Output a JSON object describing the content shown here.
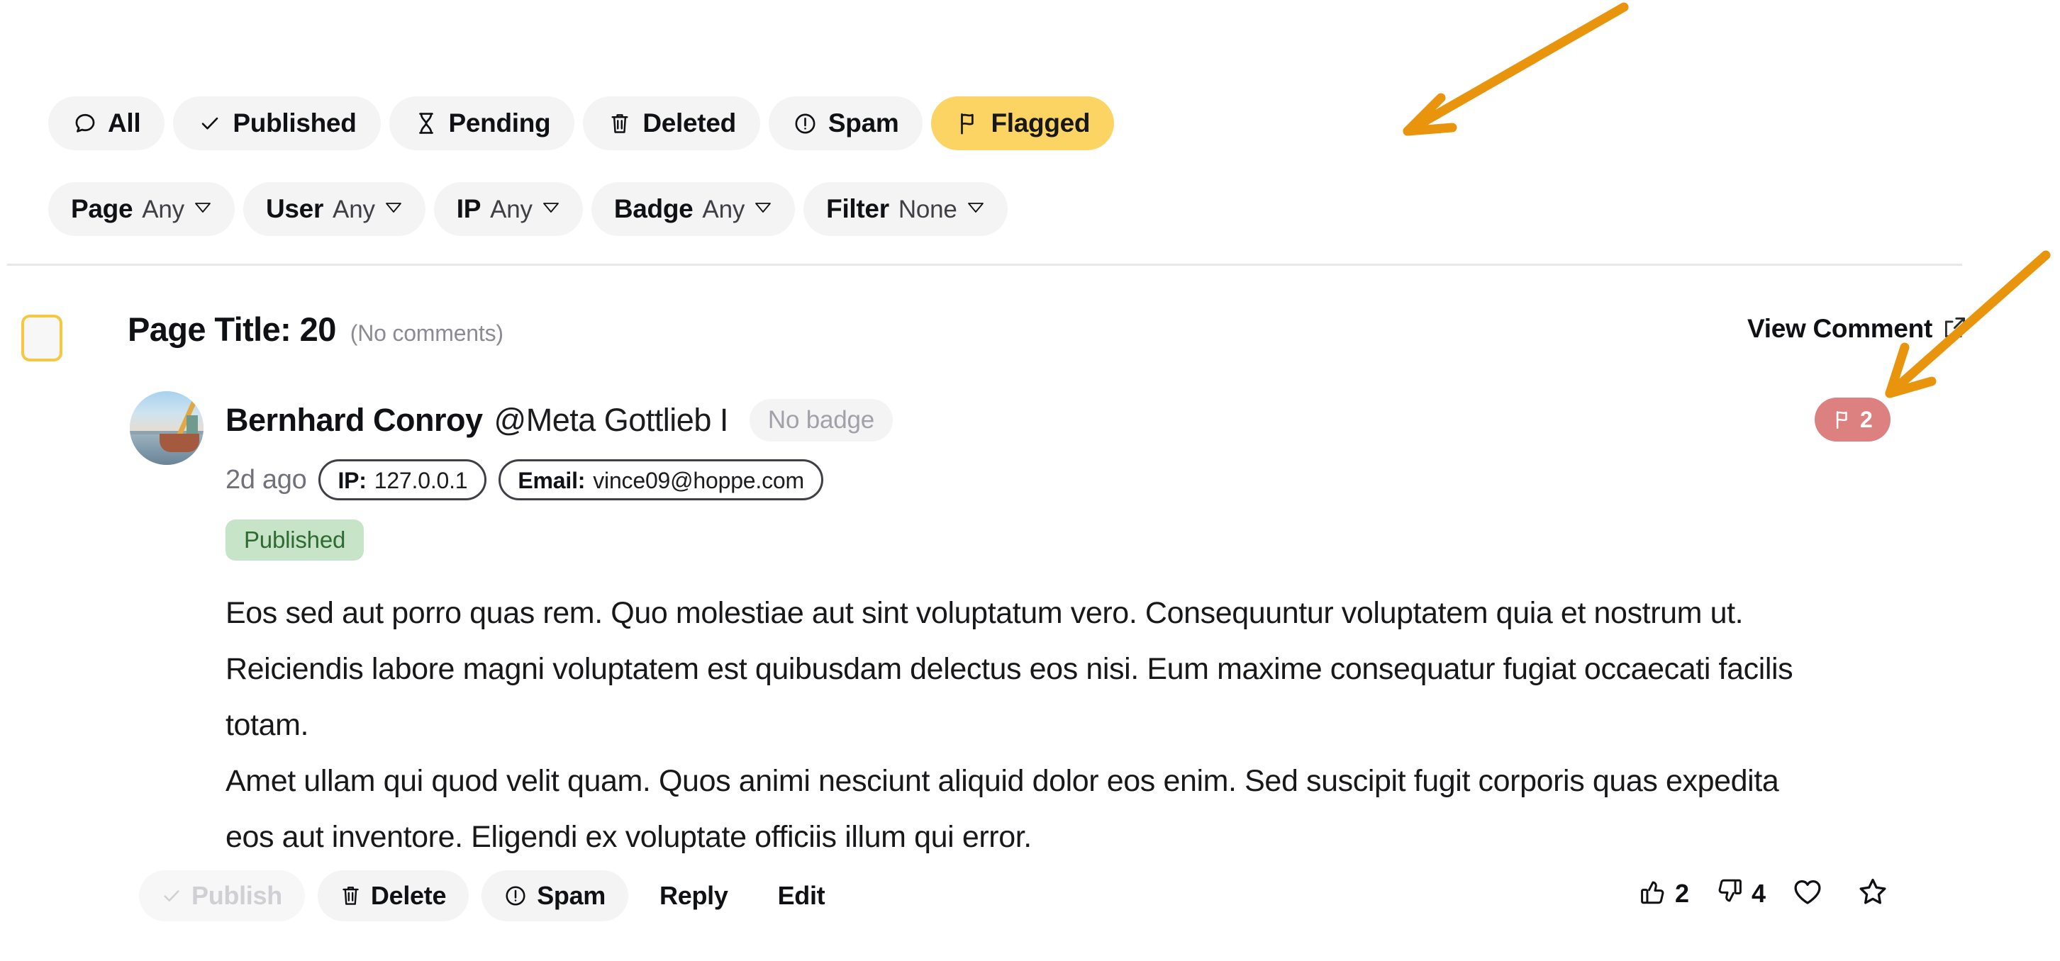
{
  "status_tabs": [
    {
      "label": "All",
      "icon": "comment-icon",
      "active": false
    },
    {
      "label": "Published",
      "icon": "check-icon",
      "active": false
    },
    {
      "label": "Pending",
      "icon": "hourglass-icon",
      "active": false
    },
    {
      "label": "Deleted",
      "icon": "trash-icon",
      "active": false
    },
    {
      "label": "Spam",
      "icon": "alert-icon",
      "active": false
    },
    {
      "label": "Flagged",
      "icon": "flag-icon",
      "active": true
    }
  ],
  "meta_filters": [
    {
      "label": "Page",
      "value": "Any"
    },
    {
      "label": "User",
      "value": "Any"
    },
    {
      "label": "IP",
      "value": "Any"
    },
    {
      "label": "Badge",
      "value": "Any"
    },
    {
      "label": "Filter",
      "value": "None"
    }
  ],
  "thread": {
    "page_title": "Page Title: 20",
    "page_title_sub": "(No comments)",
    "view_comment_label": "View Comment"
  },
  "comment": {
    "author_name": "Bernhard Conroy",
    "author_handle": "@Meta Gottlieb I",
    "badge_label": "No badge",
    "time_ago": "2d ago",
    "ip_key": "IP:",
    "ip_value": "127.0.0.1",
    "email_key": "Email:",
    "email_value": "vince09@hoppe.com",
    "status_label": "Published",
    "flag_count": "2",
    "body_paragraphs": [
      "Eos sed aut porro quas rem. Quo molestiae aut sint voluptatum vero. Consequuntur voluptatem quia et nostrum ut. Reiciendis labore magni voluptatem est quibusdam delectus eos nisi. Eum maxime consequatur fugiat occaecati facilis totam.",
      "Amet ullam qui quod velit quam. Quos animi nesciunt aliquid dolor eos enim. Sed suscipit fugit corporis quas expedita eos aut inventore. Eligendi ex voluptate officiis illum qui error."
    ]
  },
  "actions": [
    {
      "label": "Publish",
      "icon": "check-icon",
      "disabled": true,
      "plain": false
    },
    {
      "label": "Delete",
      "icon": "trash-icon",
      "disabled": false,
      "plain": false
    },
    {
      "label": "Spam",
      "icon": "alert-icon",
      "disabled": false,
      "plain": false
    },
    {
      "label": "Reply",
      "icon": "",
      "disabled": false,
      "plain": true
    },
    {
      "label": "Edit",
      "icon": "",
      "disabled": false,
      "plain": true
    }
  ],
  "reactions": [
    {
      "icon": "thumbs-up-icon",
      "count": "2"
    },
    {
      "icon": "thumbs-down-icon",
      "count": "4"
    },
    {
      "icon": "heart-icon",
      "count": ""
    },
    {
      "icon": "star-icon",
      "count": ""
    }
  ],
  "colors": {
    "active_tab_bg": "#fbd464",
    "chip_bg": "#f4f4f5",
    "status_published_bg": "#c7e3c8",
    "status_published_fg": "#2e6b33",
    "flag_badge_bg": "#dc8080",
    "annotation_arrow": "#e8940c",
    "checkbox_border": "#f5c842"
  },
  "annotations": [
    {
      "name": "arrow-to-flagged-tab",
      "target": "Flagged"
    },
    {
      "name": "arrow-to-flag-badge",
      "target": "flag count badge"
    }
  ]
}
